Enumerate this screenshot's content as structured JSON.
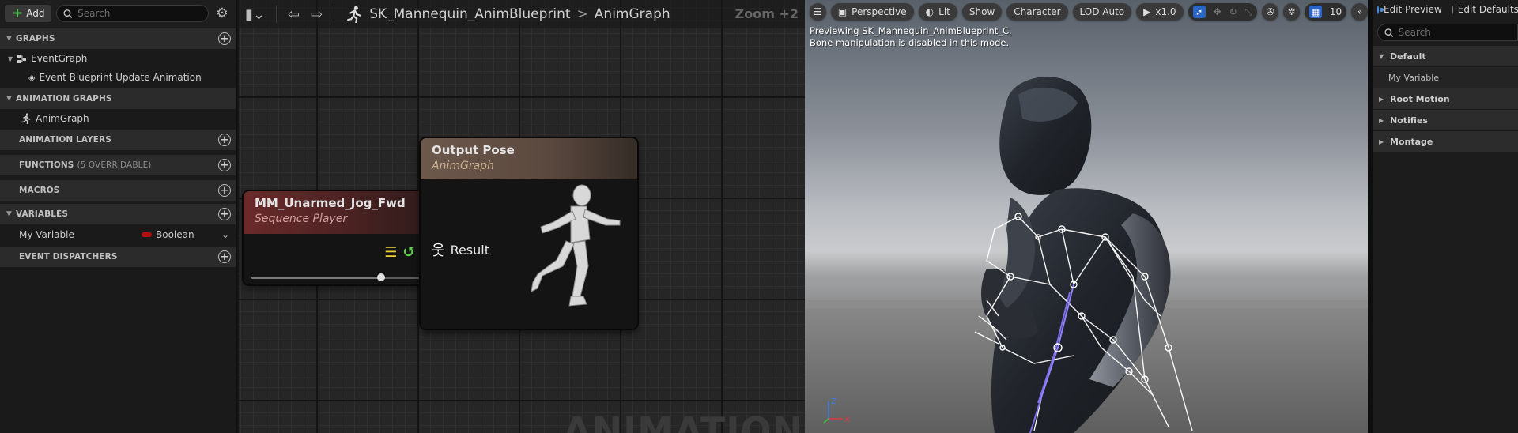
{
  "left_panel": {
    "add_label": "Add",
    "search_placeholder": "Search",
    "sections": {
      "graphs": "GRAPHS",
      "animation_graphs": "ANIMATION GRAPHS",
      "animation_layers": "ANIMATION LAYERS",
      "functions": "FUNCTIONS",
      "functions_sub": "(5 OVERRIDABLE)",
      "macros": "MACROS",
      "variables": "VARIABLES",
      "event_dispatchers": "EVENT DISPATCHERS"
    },
    "tree": {
      "event_graph": "EventGraph",
      "event_update": "Event Blueprint Update Animation",
      "anim_graph": "AnimGraph"
    },
    "variable": {
      "name": "My Variable",
      "type": "Boolean",
      "type_color": "#b01010"
    }
  },
  "graph": {
    "breadcrumb_asset": "SK_Mannequin_AnimBlueprint",
    "breadcrumb_sep": ">",
    "breadcrumb_graph": "AnimGraph",
    "zoom": "Zoom +2",
    "watermark": "ANIMATION",
    "nodes": {
      "sequence_player": {
        "title": "MM_Unarmed_Jog_Fwd",
        "subtitle": "Sequence Player",
        "slider_fraction": 0.72
      },
      "output_pose": {
        "title": "Output Pose",
        "subtitle": "AnimGraph",
        "pin_label": "Result"
      }
    }
  },
  "viewport": {
    "toolbar": {
      "perspective": "Perspective",
      "lit": "Lit",
      "show": "Show",
      "character": "Character",
      "lod": "LOD Auto",
      "playrate": "x1.0",
      "grid_value": "10"
    },
    "message_line1": "Previewing SK_Mannequin_AnimBlueprint_C.",
    "message_line2": "Bone manipulation is disabled in this mode.",
    "axis": {
      "z": "Z",
      "x": "X"
    }
  },
  "details_panel": {
    "edit_preview": "Edit Preview",
    "edit_defaults": "Edit Defaults",
    "search_placeholder": "Search",
    "categories": {
      "default": "Default",
      "root_motion": "Root Motion",
      "notifies": "Notifies",
      "montage": "Montage"
    },
    "my_variable": "My Variable"
  }
}
